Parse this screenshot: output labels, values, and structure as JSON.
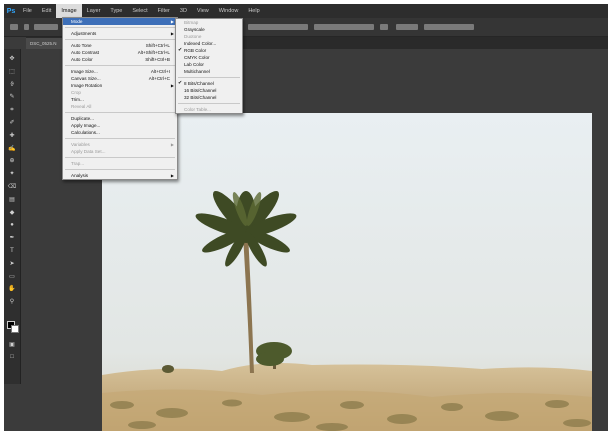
{
  "app": {
    "logo": "Ps",
    "menus": [
      "File",
      "Edit",
      "Image",
      "Layer",
      "Type",
      "Select",
      "Filter",
      "3D",
      "View",
      "Window",
      "Help"
    ],
    "active_menu": "Image"
  },
  "document_tab": "DSC_0525.N",
  "image_menu": {
    "items": [
      {
        "label": "Mode",
        "submenu": true,
        "highlight": true
      },
      {
        "sep": true
      },
      {
        "label": "Adjustments",
        "submenu": true
      },
      {
        "sep": true
      },
      {
        "label": "Auto Tone",
        "shortcut": "Shift+Ctrl+L"
      },
      {
        "label": "Auto Contrast",
        "shortcut": "Alt+Shift+Ctrl+L"
      },
      {
        "label": "Auto Color",
        "shortcut": "Shift+Ctrl+B"
      },
      {
        "sep": true
      },
      {
        "label": "Image Size...",
        "shortcut": "Alt+Ctrl+I"
      },
      {
        "label": "Canvas Size...",
        "shortcut": "Alt+Ctrl+C"
      },
      {
        "label": "Image Rotation",
        "submenu": true
      },
      {
        "label": "Crop",
        "disabled": true
      },
      {
        "label": "Trim..."
      },
      {
        "label": "Reveal All",
        "disabled": true
      },
      {
        "sep": true
      },
      {
        "label": "Duplicate..."
      },
      {
        "label": "Apply Image..."
      },
      {
        "label": "Calculations..."
      },
      {
        "sep": true
      },
      {
        "label": "Variables",
        "submenu": true,
        "disabled": true
      },
      {
        "label": "Apply Data Set...",
        "disabled": true
      },
      {
        "sep": true
      },
      {
        "label": "Trap...",
        "disabled": true
      },
      {
        "sep": true
      },
      {
        "label": "Analysis",
        "submenu": true
      }
    ]
  },
  "mode_menu": {
    "items": [
      {
        "label": "Bitmap",
        "disabled": true
      },
      {
        "label": "Grayscale"
      },
      {
        "label": "Duotone",
        "disabled": true
      },
      {
        "label": "Indexed Color..."
      },
      {
        "label": "RGB Color",
        "checked": true
      },
      {
        "label": "CMYK Color"
      },
      {
        "label": "Lab Color"
      },
      {
        "label": "Multichannel"
      },
      {
        "sep": true
      },
      {
        "label": "8 Bits/Channel",
        "checked": true
      },
      {
        "label": "16 Bits/Channel"
      },
      {
        "label": "32 Bits/Channel"
      },
      {
        "sep": true
      },
      {
        "label": "Color Table...",
        "disabled": true
      }
    ]
  },
  "toolbox": {
    "tools": [
      "move-tool-icon",
      "marquee-tool-icon",
      "lasso-tool-icon",
      "quick-select-tool-icon",
      "crop-tool-icon",
      "eyedropper-tool-icon",
      "healing-brush-tool-icon",
      "brush-tool-icon",
      "clone-stamp-tool-icon",
      "history-brush-tool-icon",
      "eraser-tool-icon",
      "gradient-tool-icon",
      "blur-tool-icon",
      "dodge-tool-icon",
      "pen-tool-icon",
      "type-tool-icon",
      "path-select-tool-icon",
      "shape-tool-icon",
      "hand-tool-icon",
      "zoom-tool-icon"
    ]
  },
  "colors": {
    "accent": "#31a8ff",
    "highlight": "#3d6fb8",
    "chrome": "#3b3b3b"
  }
}
